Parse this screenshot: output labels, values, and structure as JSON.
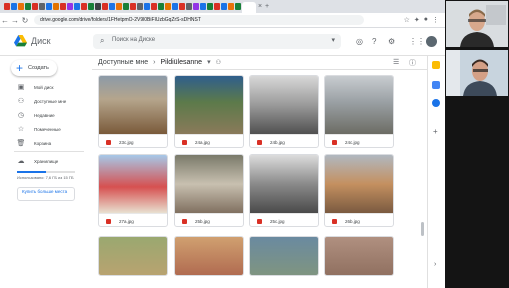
{
  "browser": {
    "url": "drive.google.com/drive/folders/1FHetpmO-2V9l0BiFIUzbGqZrS-sDHNST"
  },
  "drive": {
    "app_name": "Диск",
    "search_placeholder": "Поиск на Диске"
  },
  "sidebar": {
    "create_label": "Создать",
    "items": [
      {
        "label": "Мой диск",
        "icon": "drive-icon"
      },
      {
        "label": "Доступные мне",
        "icon": "shared-icon"
      },
      {
        "label": "Недавние",
        "icon": "clock-icon"
      },
      {
        "label": "Помеченные",
        "icon": "star-icon"
      },
      {
        "label": "Корзина",
        "icon": "trash-icon"
      }
    ],
    "storage_label": "Хранилище",
    "storage_used_text": "Использовано: 7,6 ГБ из 15 ГБ",
    "storage_fraction": 0.5,
    "buy_storage_label": "Купить больше места"
  },
  "breadcrumb": {
    "parent": "Доступные мне",
    "current": "Pildiülesanne"
  },
  "files": [
    {
      "name": "23c.jpg"
    },
    {
      "name": "24a.jpg"
    },
    {
      "name": "24b.jpg"
    },
    {
      "name": "24c.jpg"
    },
    {
      "name": "27a.jpg"
    },
    {
      "name": "25b.jpg"
    },
    {
      "name": "25c.jpg"
    },
    {
      "name": "26b.jpg"
    }
  ]
}
